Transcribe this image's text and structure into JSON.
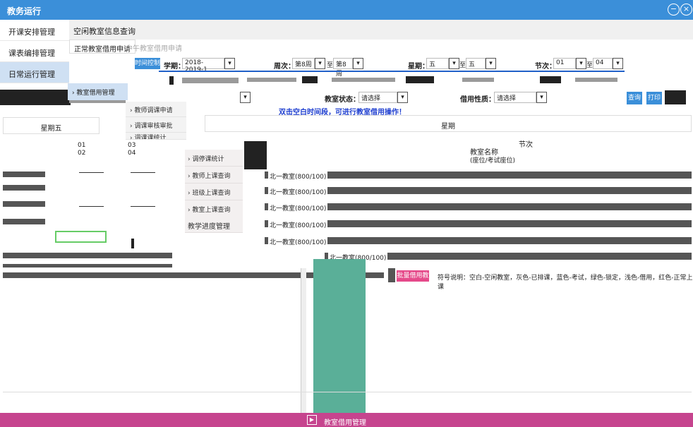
{
  "window": {
    "title": "教务运行"
  },
  "left_nav": [
    {
      "label": "开课安排管理"
    },
    {
      "label": "课表编排管理"
    },
    {
      "label": "日常运行管理"
    }
  ],
  "subnav": {
    "title": "空闲教室信息查询"
  },
  "tabs": [
    {
      "label": "正常教室借用申请"
    },
    {
      "label": "中午教室借用申请"
    }
  ],
  "filters": {
    "time_control_button": "时间控制",
    "term_label": "学期：",
    "term_value": "2018-2019-1",
    "week_label": "周次：",
    "week_from": "第8周",
    "week_to_word": "至",
    "week_to": "第8周",
    "day_label": "星期：",
    "day_from": "五",
    "day_to_word": "至",
    "day_to": "五",
    "period_label": "节次：",
    "period_from": "01",
    "period_to_word": "至",
    "period_to": "04",
    "status_label": "教室状态：",
    "status_placeholder": "请选择",
    "use_label": "借用性质：",
    "use_placeholder": "请选择",
    "query_btn": "查询",
    "print_btn": "打印"
  },
  "menu_l2": {
    "label": "› 教室借用管理"
  },
  "menu_l3": [
    {
      "label": "› 教师调课申请"
    },
    {
      "label": "› 调课审核审批"
    },
    {
      "label": "› 调课课统计"
    }
  ],
  "menu_l4": [
    {
      "label": "› 调停课统计"
    },
    {
      "label": "› 教师上课查询"
    },
    {
      "label": "› 班级上课查询"
    },
    {
      "label": "› 教室上课查询"
    },
    {
      "label": "教学进度管理"
    }
  ],
  "hint_text": "双击空白时间段，可进行教室借用操作！",
  "left_table": {
    "header": "星期五",
    "periods_col1": [
      "01",
      "02"
    ],
    "periods_col2": [
      "03",
      "04"
    ]
  },
  "grid": {
    "header": "星期",
    "section_label": "节次",
    "room_name_label": "教室名称",
    "capacity_label": "(座位/考试座位)"
  },
  "rooms": [
    {
      "name": "北一教室(800/100)"
    },
    {
      "name": "北一教室(800/100)"
    },
    {
      "name": "北一教室(800/100)"
    },
    {
      "name": "北一教室(800/100)"
    },
    {
      "name": "北一教室(800/100)"
    },
    {
      "name": "北一教室(800/100)"
    }
  ],
  "legend": {
    "button": "批量借用教室",
    "note": "符号说明：空白-空闲教室，灰色-已排课，蓝色-考试，绿色-锁定，浅色-借用，红色-正常上课"
  },
  "bottom_bar": {
    "label": "教室借用管理"
  },
  "colors": {
    "primary": "#3b8fd9",
    "magenta": "#c6448e",
    "teal": "#5aaf98",
    "pink": "#e54a8a"
  }
}
